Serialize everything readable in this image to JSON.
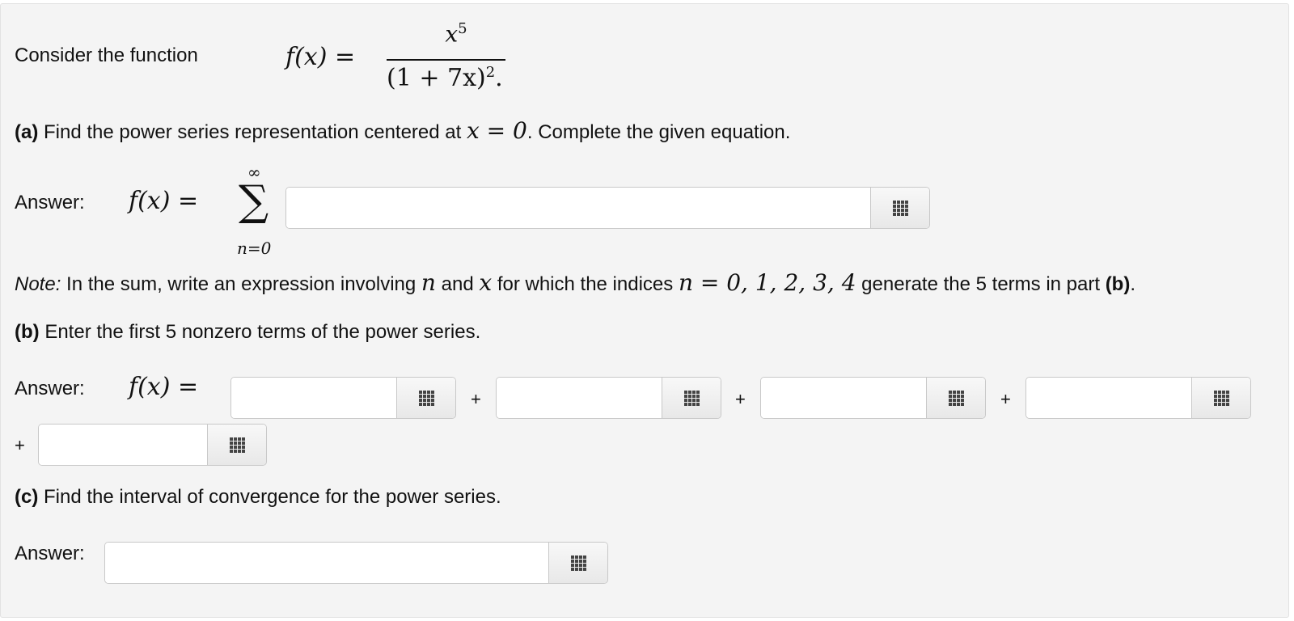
{
  "intro": {
    "text": "Consider the function",
    "lhs": "f(x) =",
    "numerator_base": "x",
    "numerator_exp": "5",
    "denominator": "(1 + 7x)",
    "denominator_exp": "2",
    "period": "."
  },
  "part_a": {
    "label": "(a)",
    "text_before": " Find the power series representation centered at ",
    "math": "x = 0",
    "text_after": ". Complete the given equation.",
    "answer_label": "Answer:",
    "lhs": "f(x) =",
    "sum_upper": "∞",
    "sum_symbol": "∑",
    "sum_lower": "n=0",
    "input_value": ""
  },
  "note": {
    "label": "Note:",
    "text1": " In the sum, write an expression involving ",
    "var_n": "n",
    "text2": " and ",
    "var_x": "x",
    "text3": " for which the indices ",
    "indices": "n = 0, 1, 2, 3, 4",
    "text4": " generate the 5 terms in part ",
    "part_ref": "(b)",
    "text5": "."
  },
  "part_b": {
    "label": "(b)",
    "text": " Enter the first 5 nonzero terms of the power series.",
    "answer_label": "Answer:",
    "lhs": "f(x) =",
    "plus": "+",
    "terms": [
      "",
      "",
      "",
      "",
      ""
    ]
  },
  "part_c": {
    "label": "(c)",
    "text": " Find the interval of convergence for the power series.",
    "answer_label": "Answer:",
    "input_value": ""
  },
  "icons": {
    "palette_button": "grid-icon"
  }
}
